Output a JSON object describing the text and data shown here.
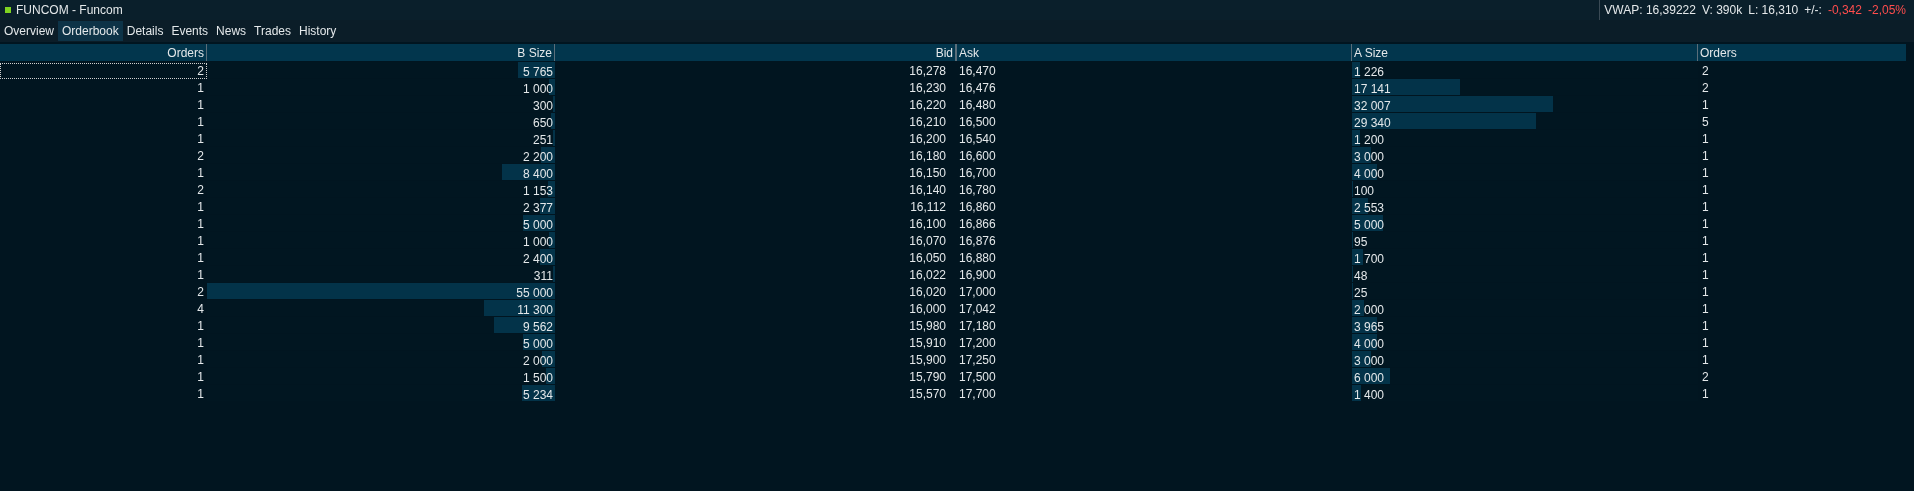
{
  "window": {
    "title": "FUNCOM - Funcom"
  },
  "stats": [
    {
      "text": "VWAP: 16,39222",
      "negative": false
    },
    {
      "text": "V: 390k",
      "negative": false
    },
    {
      "text": "L: 16,310",
      "negative": false
    },
    {
      "text": "+/-:",
      "negative": false
    },
    {
      "text": "-0,342",
      "negative": true
    },
    {
      "text": "-2,05%",
      "negative": true
    }
  ],
  "tabs": [
    {
      "label": "Overview",
      "selected": false
    },
    {
      "label": "Orderbook",
      "selected": true
    },
    {
      "label": "Details",
      "selected": false
    },
    {
      "label": "Events",
      "selected": false
    },
    {
      "label": "News",
      "selected": false
    },
    {
      "label": "Trades",
      "selected": false
    },
    {
      "label": "History",
      "selected": false
    }
  ],
  "table": {
    "columns": [
      "Orders",
      "B Size",
      "Bid",
      "Ask",
      "A Size",
      "Orders"
    ],
    "rows": [
      {
        "focused": true,
        "bid_orders": "2",
        "bid_size": {
          "text": "5 765",
          "level": 0.105
        },
        "bid": "16,278",
        "ask": "16,470",
        "ask_size": {
          "text": "1 226",
          "level": 0.022
        },
        "ask_orders": "2"
      },
      {
        "focused": false,
        "bid_orders": "1",
        "bid_size": {
          "text": "1 000",
          "level": 0.018
        },
        "bid": "16,230",
        "ask": "16,476",
        "ask_size": {
          "text": "17 141",
          "level": 0.312
        },
        "ask_orders": "2"
      },
      {
        "focused": false,
        "bid_orders": "1",
        "bid_size": {
          "text": "300",
          "level": 0.005
        },
        "bid": "16,220",
        "ask": "16,480",
        "ask_size": {
          "text": "32 007",
          "level": 0.582
        },
        "ask_orders": "1"
      },
      {
        "focused": false,
        "bid_orders": "1",
        "bid_size": {
          "text": "650",
          "level": 0.012
        },
        "bid": "16,210",
        "ask": "16,500",
        "ask_size": {
          "text": "29 340",
          "level": 0.533
        },
        "ask_orders": "5"
      },
      {
        "focused": false,
        "bid_orders": "1",
        "bid_size": {
          "text": "251",
          "level": 0.005
        },
        "bid": "16,200",
        "ask": "16,540",
        "ask_size": {
          "text": "1 200",
          "level": 0.022
        },
        "ask_orders": "1"
      },
      {
        "focused": false,
        "bid_orders": "2",
        "bid_size": {
          "text": "2 200",
          "level": 0.04
        },
        "bid": "16,180",
        "ask": "16,600",
        "ask_size": {
          "text": "3 000",
          "level": 0.055
        },
        "ask_orders": "1"
      },
      {
        "focused": false,
        "bid_orders": "1",
        "bid_size": {
          "text": "8 400",
          "level": 0.153
        },
        "bid": "16,150",
        "ask": "16,700",
        "ask_size": {
          "text": "4 000",
          "level": 0.073
        },
        "ask_orders": "1"
      },
      {
        "focused": false,
        "bid_orders": "2",
        "bid_size": {
          "text": "1 153",
          "level": 0.021
        },
        "bid": "16,140",
        "ask": "16,780",
        "ask_size": {
          "text": "100",
          "level": 0.002
        },
        "ask_orders": "1"
      },
      {
        "focused": false,
        "bid_orders": "1",
        "bid_size": {
          "text": "2 377",
          "level": 0.043
        },
        "bid": "16,112",
        "ask": "16,860",
        "ask_size": {
          "text": "2 553",
          "level": 0.046
        },
        "ask_orders": "1"
      },
      {
        "focused": false,
        "bid_orders": "1",
        "bid_size": {
          "text": "5 000",
          "level": 0.091
        },
        "bid": "16,100",
        "ask": "16,866",
        "ask_size": {
          "text": "5 000",
          "level": 0.091
        },
        "ask_orders": "1"
      },
      {
        "focused": false,
        "bid_orders": "1",
        "bid_size": {
          "text": "1 000",
          "level": 0.018
        },
        "bid": "16,070",
        "ask": "16,876",
        "ask_size": {
          "text": "95",
          "level": 0.002
        },
        "ask_orders": "1"
      },
      {
        "focused": false,
        "bid_orders": "1",
        "bid_size": {
          "text": "2 400",
          "level": 0.044
        },
        "bid": "16,050",
        "ask": "16,880",
        "ask_size": {
          "text": "1 700",
          "level": 0.031
        },
        "ask_orders": "1"
      },
      {
        "focused": false,
        "bid_orders": "1",
        "bid_size": {
          "text": "311",
          "level": 0.006
        },
        "bid": "16,022",
        "ask": "16,900",
        "ask_size": {
          "text": "48",
          "level": 0.001
        },
        "ask_orders": "1"
      },
      {
        "focused": false,
        "bid_orders": "2",
        "bid_size": {
          "text": "55 000",
          "level": 1
        },
        "bid": "16,020",
        "ask": "17,000",
        "ask_size": {
          "text": "25",
          "level": 0.0005
        },
        "ask_orders": "1"
      },
      {
        "focused": false,
        "bid_orders": "4",
        "bid_size": {
          "text": "11 300",
          "level": 0.205
        },
        "bid": "16,000",
        "ask": "17,042",
        "ask_size": {
          "text": "2 000",
          "level": 0.036
        },
        "ask_orders": "1"
      },
      {
        "focused": false,
        "bid_orders": "1",
        "bid_size": {
          "text": "9 562",
          "level": 0.174
        },
        "bid": "15,980",
        "ask": "17,180",
        "ask_size": {
          "text": "3 965",
          "level": 0.072
        },
        "ask_orders": "1"
      },
      {
        "focused": false,
        "bid_orders": "1",
        "bid_size": {
          "text": "5 000",
          "level": 0.091
        },
        "bid": "15,910",
        "ask": "17,200",
        "ask_size": {
          "text": "4 000",
          "level": 0.073
        },
        "ask_orders": "1"
      },
      {
        "focused": false,
        "bid_orders": "1",
        "bid_size": {
          "text": "2 000",
          "level": 0.036
        },
        "bid": "15,900",
        "ask": "17,250",
        "ask_size": {
          "text": "3 000",
          "level": 0.055
        },
        "ask_orders": "1"
      },
      {
        "focused": false,
        "bid_orders": "1",
        "bid_size": {
          "text": "1 500",
          "level": 0.027
        },
        "bid": "15,790",
        "ask": "17,500",
        "ask_size": {
          "text": "6 000",
          "level": 0.109
        },
        "ask_orders": "2"
      },
      {
        "focused": false,
        "bid_orders": "1",
        "bid_size": {
          "text": "5 234",
          "level": 0.095
        },
        "bid": "15,570",
        "ask": "17,700",
        "ask_size": {
          "text": "1 400",
          "level": 0.025
        },
        "ask_orders": "1"
      }
    ]
  }
}
